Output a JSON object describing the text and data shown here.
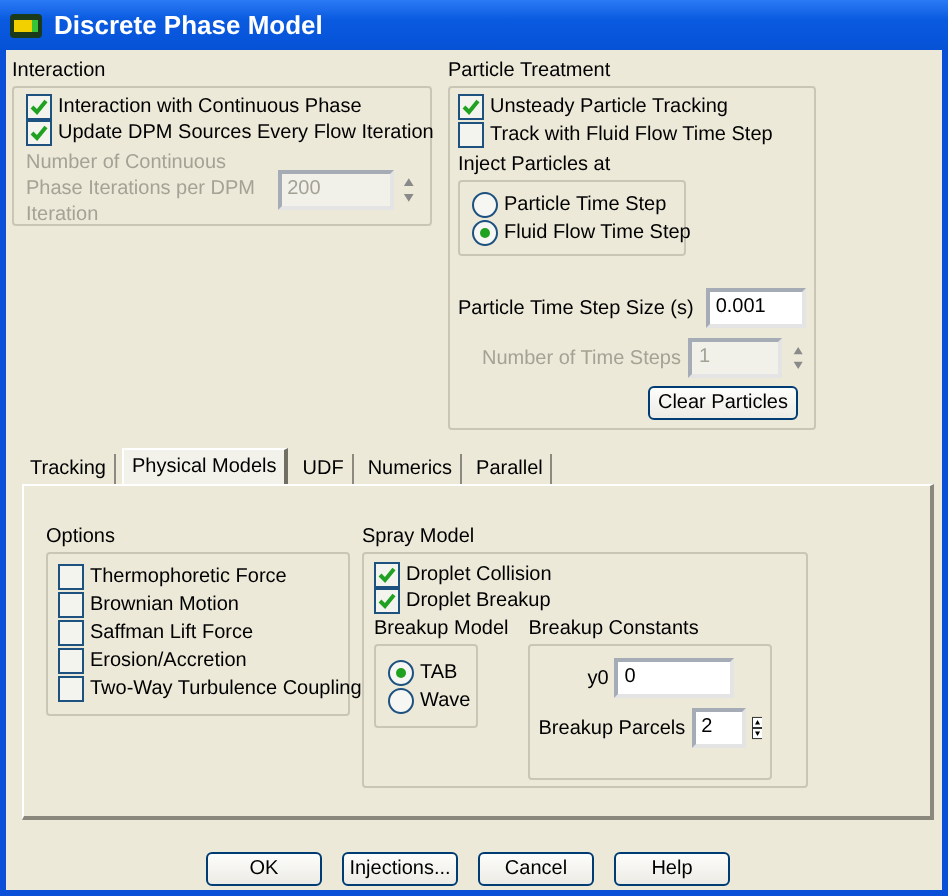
{
  "window": {
    "title": "Discrete Phase Model"
  },
  "interaction": {
    "title": "Interaction",
    "options": [
      {
        "label": "Interaction with Continuous Phase",
        "checked": true
      },
      {
        "label": "Update DPM Sources Every Flow Iteration",
        "checked": true
      }
    ],
    "iterations": {
      "label": "Number of Continuous Phase Iterations per DPM Iteration",
      "value": "200",
      "disabled": true
    }
  },
  "particle_treatment": {
    "title": "Particle Treatment",
    "options": [
      {
        "label": "Unsteady Particle Tracking",
        "checked": true
      },
      {
        "label": "Track with Fluid Flow Time Step",
        "checked": false
      }
    ],
    "inject": {
      "title": "Inject Particles at",
      "options": [
        {
          "label": "Particle Time Step",
          "selected": false
        },
        {
          "label": "Fluid Flow Time Step",
          "selected": true
        }
      ]
    },
    "time_step_size": {
      "label": "Particle Time Step Size (s)",
      "value": "0.001"
    },
    "number_of_time_steps": {
      "label": "Number of Time Steps",
      "value": "1",
      "disabled": true
    },
    "clear_button": "Clear Particles"
  },
  "tabs": [
    {
      "label": "Tracking",
      "selected": false
    },
    {
      "label": "Physical Models",
      "selected": true
    },
    {
      "label": "UDF",
      "selected": false
    },
    {
      "label": "Numerics",
      "selected": false
    },
    {
      "label": "Parallel",
      "selected": false
    }
  ],
  "options": {
    "title": "Options",
    "items": [
      {
        "label": "Thermophoretic Force",
        "checked": false
      },
      {
        "label": "Brownian Motion",
        "checked": false
      },
      {
        "label": "Saffman Lift Force",
        "checked": false
      },
      {
        "label": "Erosion/Accretion",
        "checked": false
      },
      {
        "label": "Two-Way Turbulence Coupling",
        "checked": false
      }
    ]
  },
  "spray_model": {
    "title": "Spray Model",
    "items": [
      {
        "label": "Droplet Collision",
        "checked": true
      },
      {
        "label": "Droplet Breakup",
        "checked": true
      }
    ],
    "breakup_model": {
      "title": "Breakup Model",
      "options": [
        {
          "label": "TAB",
          "selected": true
        },
        {
          "label": "Wave",
          "selected": false
        }
      ]
    },
    "breakup_constants": {
      "title": "Breakup Constants",
      "fields": [
        {
          "kind": "text",
          "label": "y0",
          "value": "0"
        },
        {
          "kind": "spin",
          "label": "Breakup Parcels",
          "value": "2"
        }
      ]
    }
  },
  "buttons": [
    "OK",
    "Injections...",
    "Cancel",
    "Help"
  ]
}
